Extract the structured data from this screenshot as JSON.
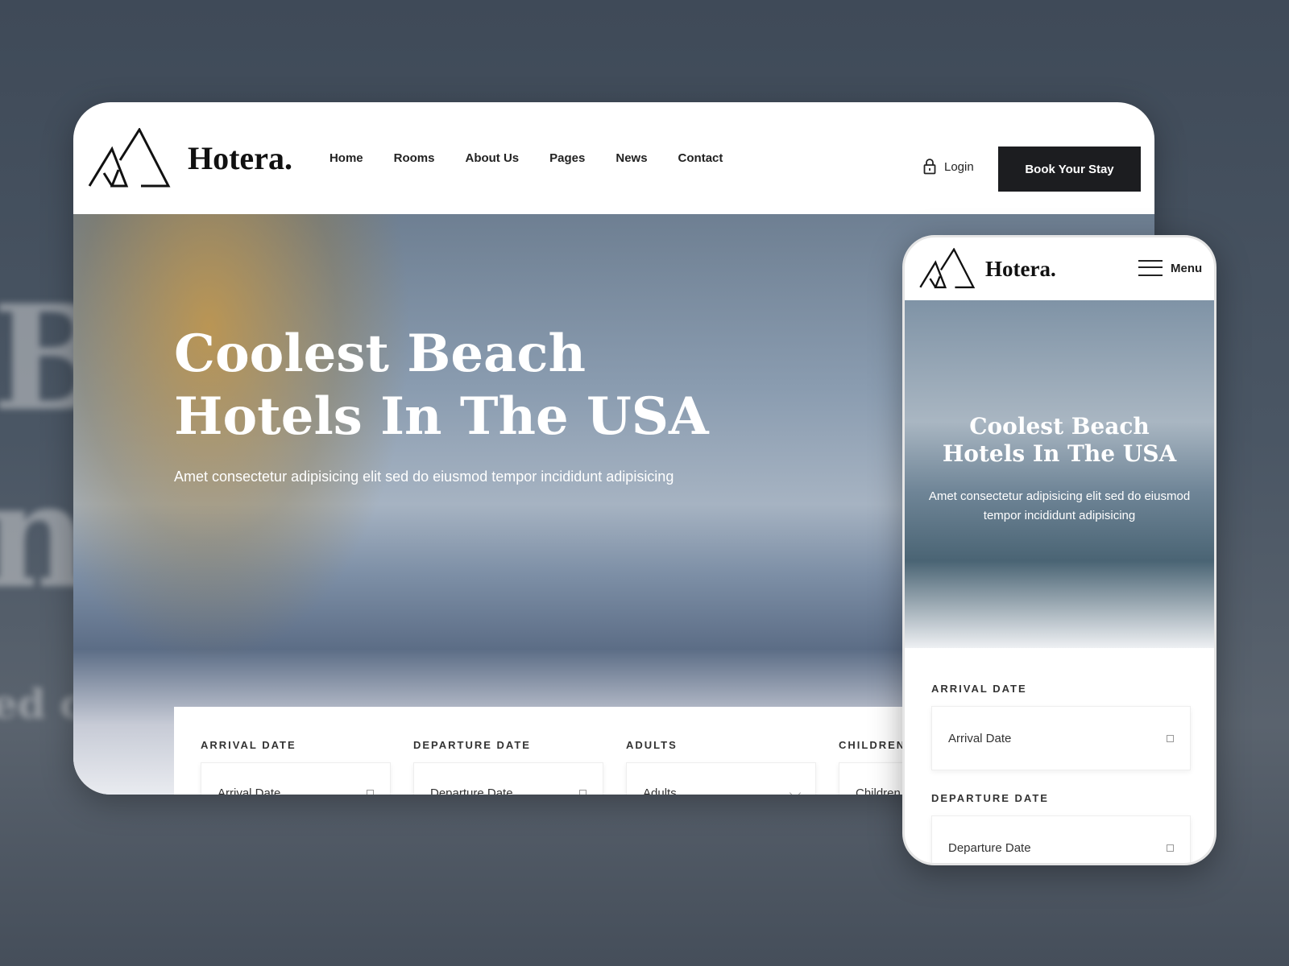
{
  "background": {
    "letters": [
      "B",
      "n",
      "ed c"
    ]
  },
  "desktop": {
    "brand": "Hotera.",
    "nav": [
      "Home",
      "Rooms",
      "About Us",
      "Pages",
      "News",
      "Contact"
    ],
    "login": "Login",
    "book_button": "Book Your Stay",
    "hero": {
      "title_line1": "Coolest Beach",
      "title_line2": "Hotels In The USA",
      "subtitle": "Amet consectetur adipisicing elit sed do eiusmod tempor incididunt adipisicing"
    },
    "booking": [
      {
        "label": "ARRIVAL DATE",
        "value": "Arrival Date",
        "icon": "calendar-icon"
      },
      {
        "label": "DEPARTURE DATE",
        "value": "Departure Date",
        "icon": "calendar-icon"
      },
      {
        "label": "ADULTS",
        "value": "Adults",
        "icon": "chevron-down-icon"
      },
      {
        "label": "CHILDREN",
        "value": "Children",
        "icon": "chevron-down-icon"
      }
    ]
  },
  "mobile": {
    "brand": "Hotera.",
    "menu": "Menu",
    "hero": {
      "title_line1": "Coolest Beach",
      "title_line2": "Hotels In The USA",
      "subtitle": "Amet consectetur adipisicing elit sed do eiusmod tempor incididunt adipisicing"
    },
    "booking": [
      {
        "label": "ARRIVAL DATE",
        "value": "Arrival Date"
      },
      {
        "label": "DEPARTURE DATE",
        "value": "Departure Date"
      }
    ]
  }
}
